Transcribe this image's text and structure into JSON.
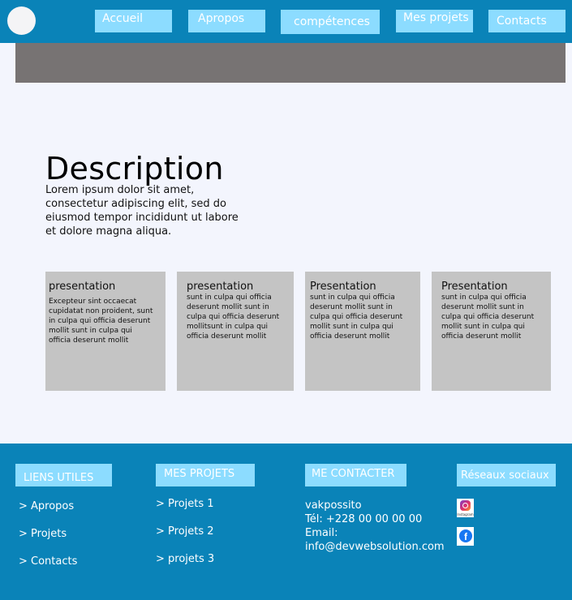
{
  "nav": {
    "items": [
      {
        "label": "Accueil"
      },
      {
        "label": "Apropos"
      },
      {
        "label": "compétences"
      },
      {
        "label": "Mes projets"
      },
      {
        "label": "Contacts"
      }
    ]
  },
  "description": {
    "title": "Description",
    "text": "Lorem ipsum dolor sit amet, consectetur adipiscing elit, sed do eiusmod tempor incididunt ut labore et dolore magna aliqua."
  },
  "cards": [
    {
      "title": "presentation",
      "text": "Excepteur sint occaecat cupidatat non proident, sunt in culpa qui officia deserunt mollit sunt in culpa qui officia deserunt mollit"
    },
    {
      "title": "presentation",
      "text": "sunt in culpa qui officia deserunt mollit sunt in culpa qui officia deserunt mollitsunt in culpa qui officia deserunt mollit"
    },
    {
      "title": "Presentation",
      "text": "sunt in culpa qui officia deserunt mollit sunt in culpa qui officia deserunt mollit sunt in culpa qui officia deserunt mollit"
    },
    {
      "title": "Presentation",
      "text": "sunt in culpa qui officia deserunt mollit sunt in culpa qui officia deserunt mollit sunt in culpa qui officia deserunt mollit"
    }
  ],
  "footer": {
    "useful_links": {
      "heading": "LIENS UTILES",
      "links": [
        "> Apropos",
        "> Projets",
        "> Contacts"
      ]
    },
    "projects": {
      "heading": "MES PROJETS",
      "links": [
        "> Projets 1",
        "> Projets 2",
        "> projets 3"
      ]
    },
    "contact": {
      "heading": "ME CONTACTER",
      "name": "vakpossito",
      "phone": "Tél: +228 00 00 00 00",
      "email_label": "Email:",
      "email": "info@devwebsolution.com"
    },
    "social": {
      "heading": "Réseaux sociaux",
      "instagram_caption": "Instagram",
      "icons": [
        "instagram-icon",
        "facebook-icon"
      ]
    }
  },
  "colors": {
    "header_bg": "#0a83b8",
    "nav_button_bg": "#8cdcff",
    "hero_strip": "#777373",
    "page_bg": "#f3f5fd",
    "card_bg": "#c4c4c4"
  }
}
